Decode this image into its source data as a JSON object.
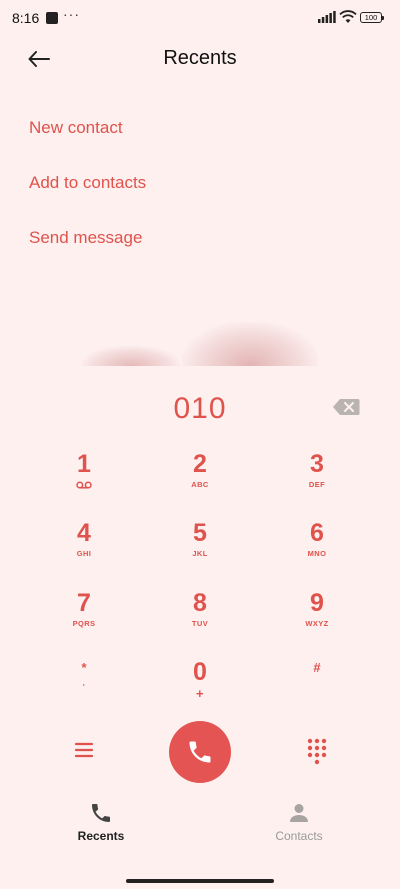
{
  "status_bar": {
    "time": "8:16",
    "dots": "···",
    "battery": "100"
  },
  "header": {
    "title": "Recents"
  },
  "options": [
    {
      "label": "New contact"
    },
    {
      "label": "Add to contacts"
    },
    {
      "label": "Send message"
    }
  ],
  "dialed_number": "010",
  "keypad": [
    {
      "digit": "1",
      "letters": ""
    },
    {
      "digit": "2",
      "letters": "ABC"
    },
    {
      "digit": "3",
      "letters": "DEF"
    },
    {
      "digit": "4",
      "letters": "GHI"
    },
    {
      "digit": "5",
      "letters": "JKL"
    },
    {
      "digit": "6",
      "letters": "MNO"
    },
    {
      "digit": "7",
      "letters": "PQRS"
    },
    {
      "digit": "8",
      "letters": "TUV"
    },
    {
      "digit": "9",
      "letters": "WXYZ"
    },
    {
      "digit": "*",
      "letters": "'"
    },
    {
      "digit": "0",
      "letters": "+"
    },
    {
      "digit": "#",
      "letters": ""
    }
  ],
  "bottom_nav": {
    "recents": {
      "label": "Recents",
      "active": true
    },
    "contacts": {
      "label": "Contacts",
      "active": false
    }
  },
  "colors": {
    "accent": "#e0524c",
    "background": "#fdf0ef",
    "call_button": "#e35452",
    "inactive": "#9a9a9a"
  }
}
